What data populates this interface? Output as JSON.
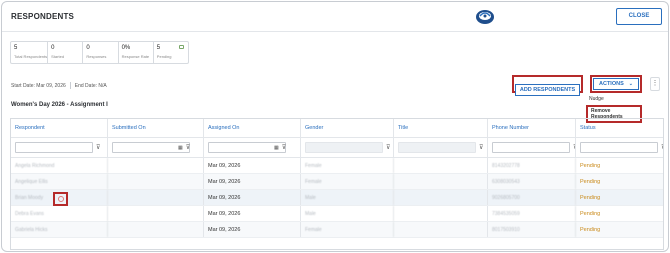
{
  "header": {
    "title": "RESPONDENTS",
    "close_label": "CLOSE"
  },
  "stats": [
    {
      "value": "5",
      "label": "Total Respondents"
    },
    {
      "value": "0",
      "label": "Started"
    },
    {
      "value": "0",
      "label": "Responses"
    },
    {
      "value": "0%",
      "label": "Response Rate"
    },
    {
      "value": "5",
      "label": "Pending"
    }
  ],
  "dates": {
    "start": "Start Date: Mar 09, 2026",
    "end": "End Date: N/A"
  },
  "assignment_title": "Women's Day 2026 - Assignment I",
  "toolbar": {
    "add_label": "ADD RESPONDENTS",
    "actions_label": "ACTIONS",
    "kebab_glyph": "⋮",
    "dropdown": {
      "nudge": "Nudge",
      "remove": "Remove Respondents"
    }
  },
  "table": {
    "columns": [
      "Respondent",
      "Submitted On",
      "Assigned On",
      "Gender",
      "Title",
      "Phone Number",
      "Status"
    ],
    "rows": [
      {
        "respondent": "Angela Richmond",
        "submitted": "",
        "assigned": "Mar 09, 2026",
        "gender": "Female",
        "title": "",
        "phone": "8143202778",
        "status": "Pending"
      },
      {
        "respondent": "Angelique Ellis",
        "submitted": "",
        "assigned": "Mar 09, 2026",
        "gender": "Female",
        "title": "",
        "phone": "6308030543",
        "status": "Pending"
      },
      {
        "respondent": "Brian Moody",
        "submitted": "",
        "assigned": "Mar 09, 2026",
        "gender": "Male",
        "title": "",
        "phone": "9026805700",
        "status": "Pending"
      },
      {
        "respondent": "Debra Evans",
        "submitted": "",
        "assigned": "Mar 09, 2026",
        "gender": "Male",
        "title": "",
        "phone": "7384535059",
        "status": "Pending"
      },
      {
        "respondent": "Gabriela Hicks",
        "submitted": "",
        "assigned": "Mar 09, 2026",
        "gender": "Female",
        "title": "",
        "phone": "8017503910",
        "status": "Pending"
      }
    ]
  },
  "colors": {
    "accent": "#2a6fbe",
    "highlight": "#b52a2a",
    "pending": "#c98a1a"
  }
}
